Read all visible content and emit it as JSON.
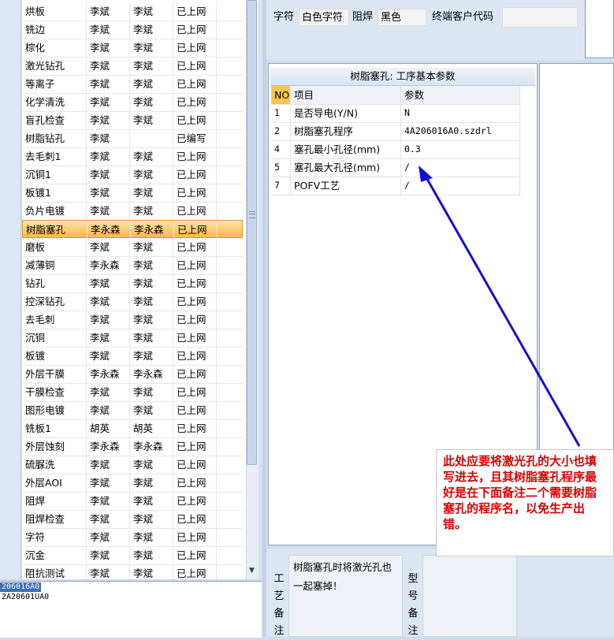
{
  "process_list": {
    "rows": [
      {
        "name": "烘板",
        "col2": "李斌",
        "col3": "李斌",
        "status": "已上网"
      },
      {
        "name": "铣边",
        "col2": "李斌",
        "col3": "李斌",
        "status": "已上网"
      },
      {
        "name": "棕化",
        "col2": "李斌",
        "col3": "李斌",
        "status": "已上网"
      },
      {
        "name": "激光钻孔",
        "col2": "李斌",
        "col3": "李斌",
        "status": "已上网"
      },
      {
        "name": "等离子",
        "col2": "李斌",
        "col3": "李斌",
        "status": "已上网"
      },
      {
        "name": "化学清洗",
        "col2": "李斌",
        "col3": "李斌",
        "status": "已上网"
      },
      {
        "name": "盲孔检查",
        "col2": "李斌",
        "col3": "李斌",
        "status": "已上网"
      },
      {
        "name": "树脂钻孔",
        "col2": "李斌",
        "col3": "",
        "status": "已编写"
      },
      {
        "name": "去毛刺1",
        "col2": "李斌",
        "col3": "李斌",
        "status": "已上网"
      },
      {
        "name": "沉铜1",
        "col2": "李斌",
        "col3": "李斌",
        "status": "已上网"
      },
      {
        "name": "板镀1",
        "col2": "李斌",
        "col3": "李斌",
        "status": "已上网"
      },
      {
        "name": "负片电镀",
        "col2": "李斌",
        "col3": "李斌",
        "status": "已上网"
      },
      {
        "name": "树脂塞孔",
        "col2": "李永森",
        "col3": "李永森",
        "status": "已上网"
      },
      {
        "name": "磨板",
        "col2": "李斌",
        "col3": "李斌",
        "status": "已上网"
      },
      {
        "name": "减薄铜",
        "col2": "李永森",
        "col3": "李斌",
        "status": "已上网"
      },
      {
        "name": "钻孔",
        "col2": "李斌",
        "col3": "李斌",
        "status": "已上网"
      },
      {
        "name": "控深钻孔",
        "col2": "李斌",
        "col3": "李斌",
        "status": "已上网"
      },
      {
        "name": "去毛刺",
        "col2": "李斌",
        "col3": "李斌",
        "status": "已上网"
      },
      {
        "name": "沉铜",
        "col2": "李斌",
        "col3": "李斌",
        "status": "已上网"
      },
      {
        "name": "板镀",
        "col2": "李斌",
        "col3": "李斌",
        "status": "已上网"
      },
      {
        "name": "外层干膜",
        "col2": "李永森",
        "col3": "李永森",
        "status": "已上网"
      },
      {
        "name": "干膜检查",
        "col2": "李斌",
        "col3": "李斌",
        "status": "已上网"
      },
      {
        "name": "图形电镀",
        "col2": "李斌",
        "col3": "李斌",
        "status": "已上网"
      },
      {
        "name": "铣板1",
        "col2": "胡英",
        "col3": "胡英",
        "status": "已上网"
      },
      {
        "name": "外层蚀刻",
        "col2": "李永森",
        "col3": "李永森",
        "status": "已上网"
      },
      {
        "name": "硫脲洗",
        "col2": "李斌",
        "col3": "李斌",
        "status": "已上网"
      },
      {
        "name": "外层AOI",
        "col2": "李斌",
        "col3": "李斌",
        "status": "已上网"
      },
      {
        "name": "阻焊",
        "col2": "李斌",
        "col3": "李斌",
        "status": "已上网"
      },
      {
        "name": "阻焊检查",
        "col2": "李斌",
        "col3": "李斌",
        "status": "已上网"
      },
      {
        "name": "字符",
        "col2": "李斌",
        "col3": "李斌",
        "status": "已上网"
      },
      {
        "name": "沉金",
        "col2": "李斌",
        "col3": "李斌",
        "status": "已上网"
      },
      {
        "name": "阻抗测试",
        "col2": "李斌",
        "col3": "李斌",
        "status": "已上网"
      }
    ],
    "selected_index": 12
  },
  "bottom_left": {
    "line1": "206016A0",
    "line2": "2A20601UA0"
  },
  "top_right": {
    "char_label": "字符",
    "char_value": "白色字符",
    "solder_label": "阻焊",
    "solder_value": "黑色",
    "customer_code_label": "终端客户代码",
    "customer_code_value": ""
  },
  "params_panel": {
    "title": "树脂塞孔: 工序基本参数",
    "headers": [
      "NO",
      "项目",
      "参数"
    ],
    "rows": [
      {
        "no": "1",
        "item": "是否导电(Y/N)",
        "value": "N"
      },
      {
        "no": "2",
        "item": "树脂塞孔程序",
        "value": "4A206016A0.szdrl"
      },
      {
        "no": "4",
        "item": "塞孔最小孔径(mm)",
        "value": "0.3"
      },
      {
        "no": "5",
        "item": "塞孔最大孔径(mm)",
        "value": "/"
      },
      {
        "no": "7",
        "item": "POFV工艺",
        "value": "/"
      }
    ]
  },
  "memo": {
    "process_label_chars": [
      "工",
      "艺",
      "备",
      "注"
    ],
    "process_text": "树脂塞孔时将激光孔也一起塞掉！",
    "model_label_chars": [
      "型",
      "号",
      "备",
      "注"
    ]
  },
  "annotation": {
    "text": "此处应要将激光孔的大小也填写进去，且其树脂塞孔程序最好是在下面备注二个需要树脂塞孔的程序名，以免生产出错。",
    "color": "#d60000",
    "arrow_color": "#1010d0"
  }
}
